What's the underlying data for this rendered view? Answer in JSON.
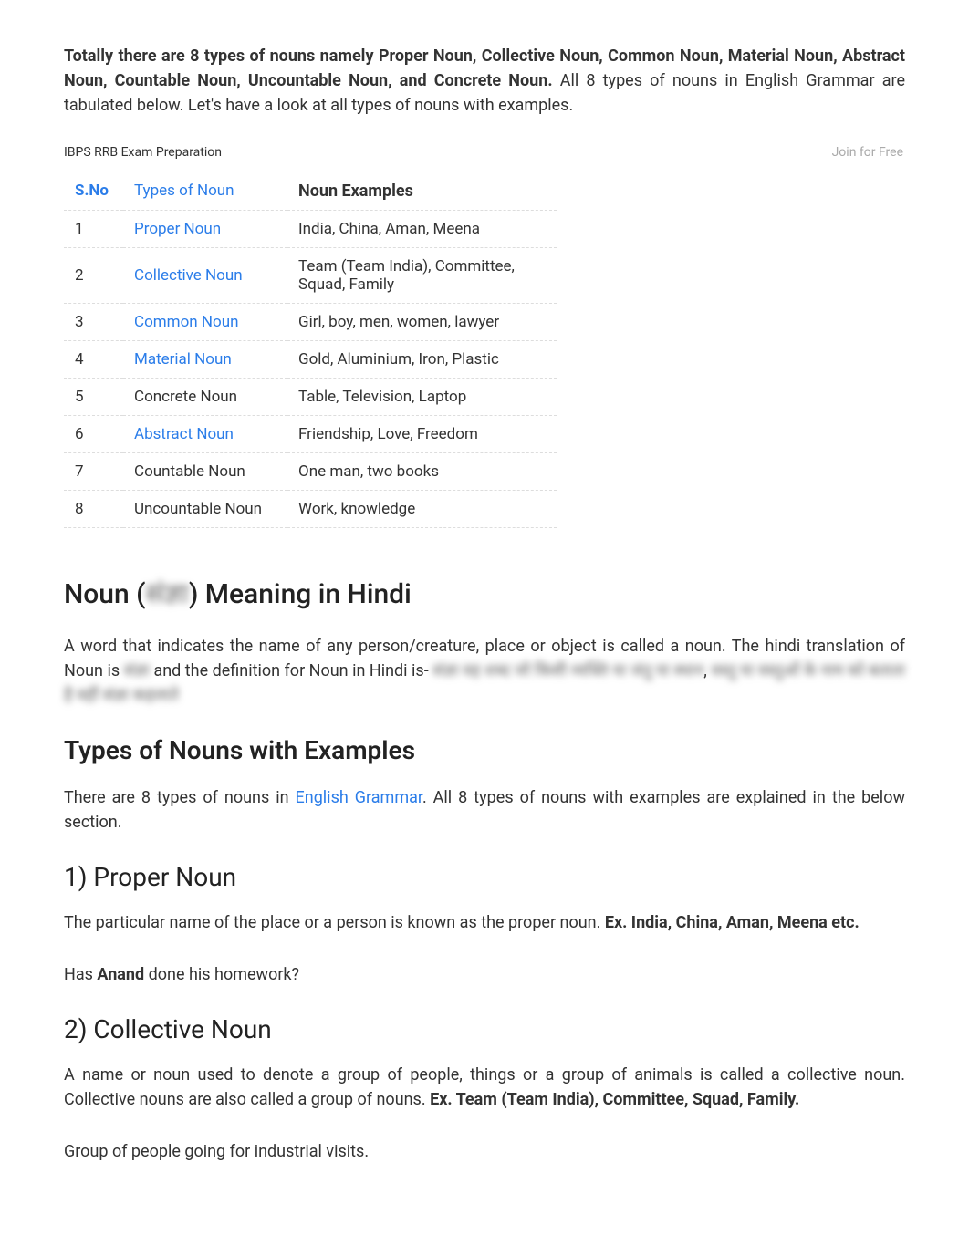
{
  "header": {
    "left_text": "IBPS RRB Exam Preparation",
    "right_text": "Join for Free",
    "overlap_text": "S.No"
  },
  "intro": {
    "bold_part": "Totally there are 8 types of nouns namely Proper Noun, Collective Noun, Common Noun, Material Noun, Abstract Noun,",
    "bold_part2": " Countable Noun, Uncountable Noun, and Concrete Noun.",
    "rest": "  All 8 types of nouns in English Grammar are tabulated below. Let's have a look at all types of nouns with examples."
  },
  "table": {
    "headers": {
      "sno": "S.No",
      "type": "Types of Noun",
      "examples": "Noun Examples"
    },
    "rows": [
      {
        "sno": "1",
        "type": "Proper Noun",
        "examples": "India, China, Aman, Meena",
        "is_link": true
      },
      {
        "sno": "2",
        "type": "Collective Noun",
        "examples": "Team (Team India), Committee, Squad, Family",
        "is_link": true
      },
      {
        "sno": "3",
        "type": "Common Noun",
        "examples": "Girl, boy, men, women, lawyer",
        "is_link": true
      },
      {
        "sno": "4",
        "type": "Material Noun",
        "examples": "Gold, Aluminium, Iron, Plastic",
        "is_link": true
      },
      {
        "sno": "5",
        "type": "Concrete Noun",
        "examples": "Table, Television, Laptop",
        "is_link": false
      },
      {
        "sno": "6",
        "type": "Abstract Noun",
        "examples": "Friendship, Love, Freedom",
        "is_link": true
      },
      {
        "sno": "7",
        "type": "Countable Noun",
        "examples": "One man, two books",
        "is_link": false
      },
      {
        "sno": "8",
        "type": "Uncountable Noun",
        "examples": "Work, knowledge",
        "is_link": false
      }
    ]
  },
  "hindi_section": {
    "heading_pre": "Noun (",
    "heading_blur": "संज्ञा",
    "heading_post": ") Meaning in Hindi",
    "para_pre": "A word that indicates the name of any person/creature, place or object is called a noun. The hindi translation of Noun is ",
    "para_blur1": "संज्ञा",
    "para_mid": " and the definition for Noun in Hindi is- ",
    "para_blur2": "संज्ञा वह शब्द जो किसी व्यक्ति या जंतु या स्थान",
    "para_comma": ", ",
    "para_blur3": "वस्तु या वस्तुओं के नाम को बताता है वहीं संज्ञा कहलाते"
  },
  "types_section": {
    "heading": "Types of Nouns with Examples",
    "para_pre": "There are 8 types of nouns in ",
    "link_text": "English Grammar",
    "para_post": ". All 8 types of nouns with examples are explained in the below section."
  },
  "proper_noun": {
    "heading": "1) Proper Noun",
    "para_pre": "The particular name of the place or a person is known as the proper noun. ",
    "bold": "Ex. India, China, Aman, Meena etc.",
    "sentence_pre": "Has ",
    "sentence_bold": "Anand",
    "sentence_post": " done his homework?"
  },
  "collective_noun": {
    "heading": "2) Collective Noun",
    "para_pre": "A name or noun used to denote a group of people, things or a group of animals is called a collective noun. Collective nouns are also called a group of nouns.  ",
    "bold": "Ex. Team (Team India), Committee, Squad, Family.",
    "sentence": "Group of people going for industrial visits."
  }
}
